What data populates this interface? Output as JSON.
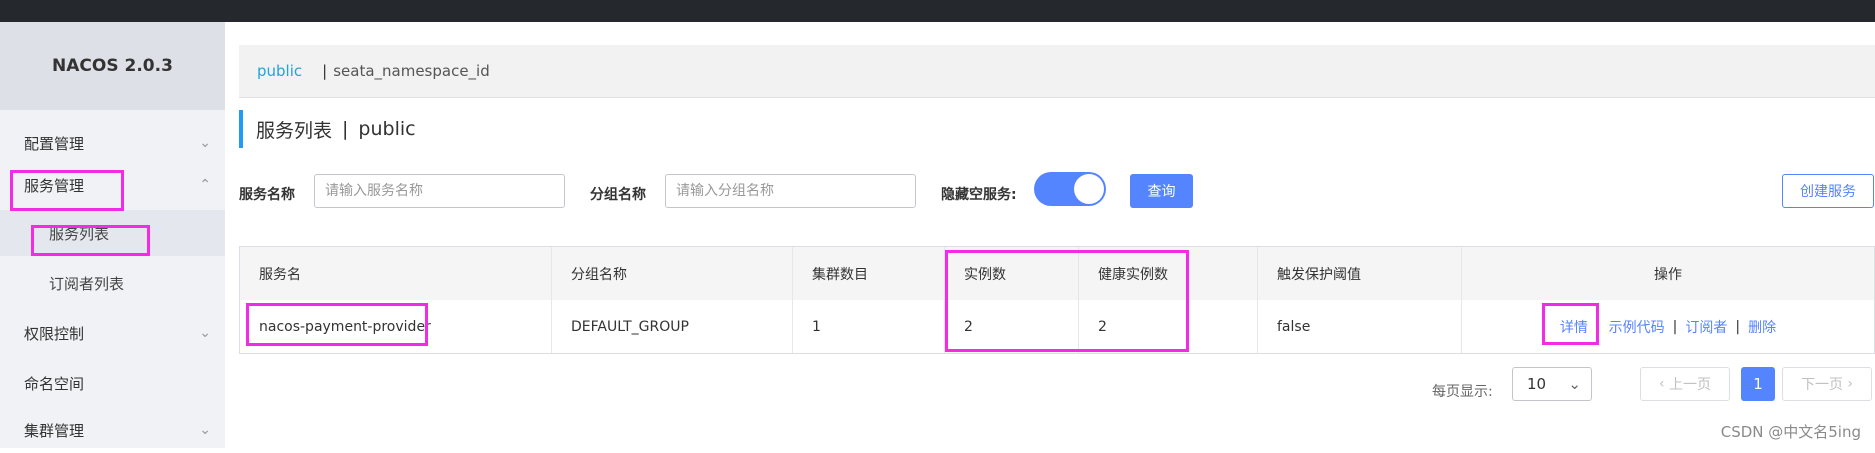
{
  "sidebar": {
    "brand": "NACOS 2.0.3",
    "items": [
      {
        "label": "配置管理",
        "chevron": "⌄"
      },
      {
        "label": "服务管理",
        "chevron": "⌃"
      },
      {
        "label": "服务列表"
      },
      {
        "label": "订阅者列表"
      },
      {
        "label": "权限控制",
        "chevron": "⌄"
      },
      {
        "label": "命名空间"
      },
      {
        "label": "集群管理",
        "chevron": "⌄"
      }
    ]
  },
  "namespace": {
    "active": "public",
    "separator": "|",
    "other": "seata_namespace_id"
  },
  "page": {
    "title": "服务列表",
    "sep": "|",
    "namespace": "public"
  },
  "filters": {
    "service_label": "服务名称",
    "service_placeholder": "请输入服务名称",
    "group_label": "分组名称",
    "group_placeholder": "请输入分组名称",
    "hide_empty_label": "隐藏空服务:",
    "query_button": "查询",
    "create_button": "创建服务"
  },
  "table": {
    "headers": [
      "服务名",
      "分组名称",
      "集群数目",
      "实例数",
      "健康实例数",
      "触发保护阈值",
      "操作"
    ],
    "rows": [
      {
        "name": "nacos-payment-provider",
        "group": "DEFAULT_GROUP",
        "clusters": "1",
        "instances": "2",
        "healthy": "2",
        "threshold": "false"
      }
    ],
    "actions": [
      "详情",
      "示例代码",
      "订阅者",
      "删除"
    ]
  },
  "pagination": {
    "per_page_label": "每页显示:",
    "per_page": "10",
    "prev": "上一页",
    "current": "1",
    "next": "下一页"
  },
  "watermark": "CSDN @中文名5ing",
  "colors": {
    "accent": "#5584ff",
    "highlight": "#f22ce6",
    "ns_active": "#21a4d6"
  }
}
